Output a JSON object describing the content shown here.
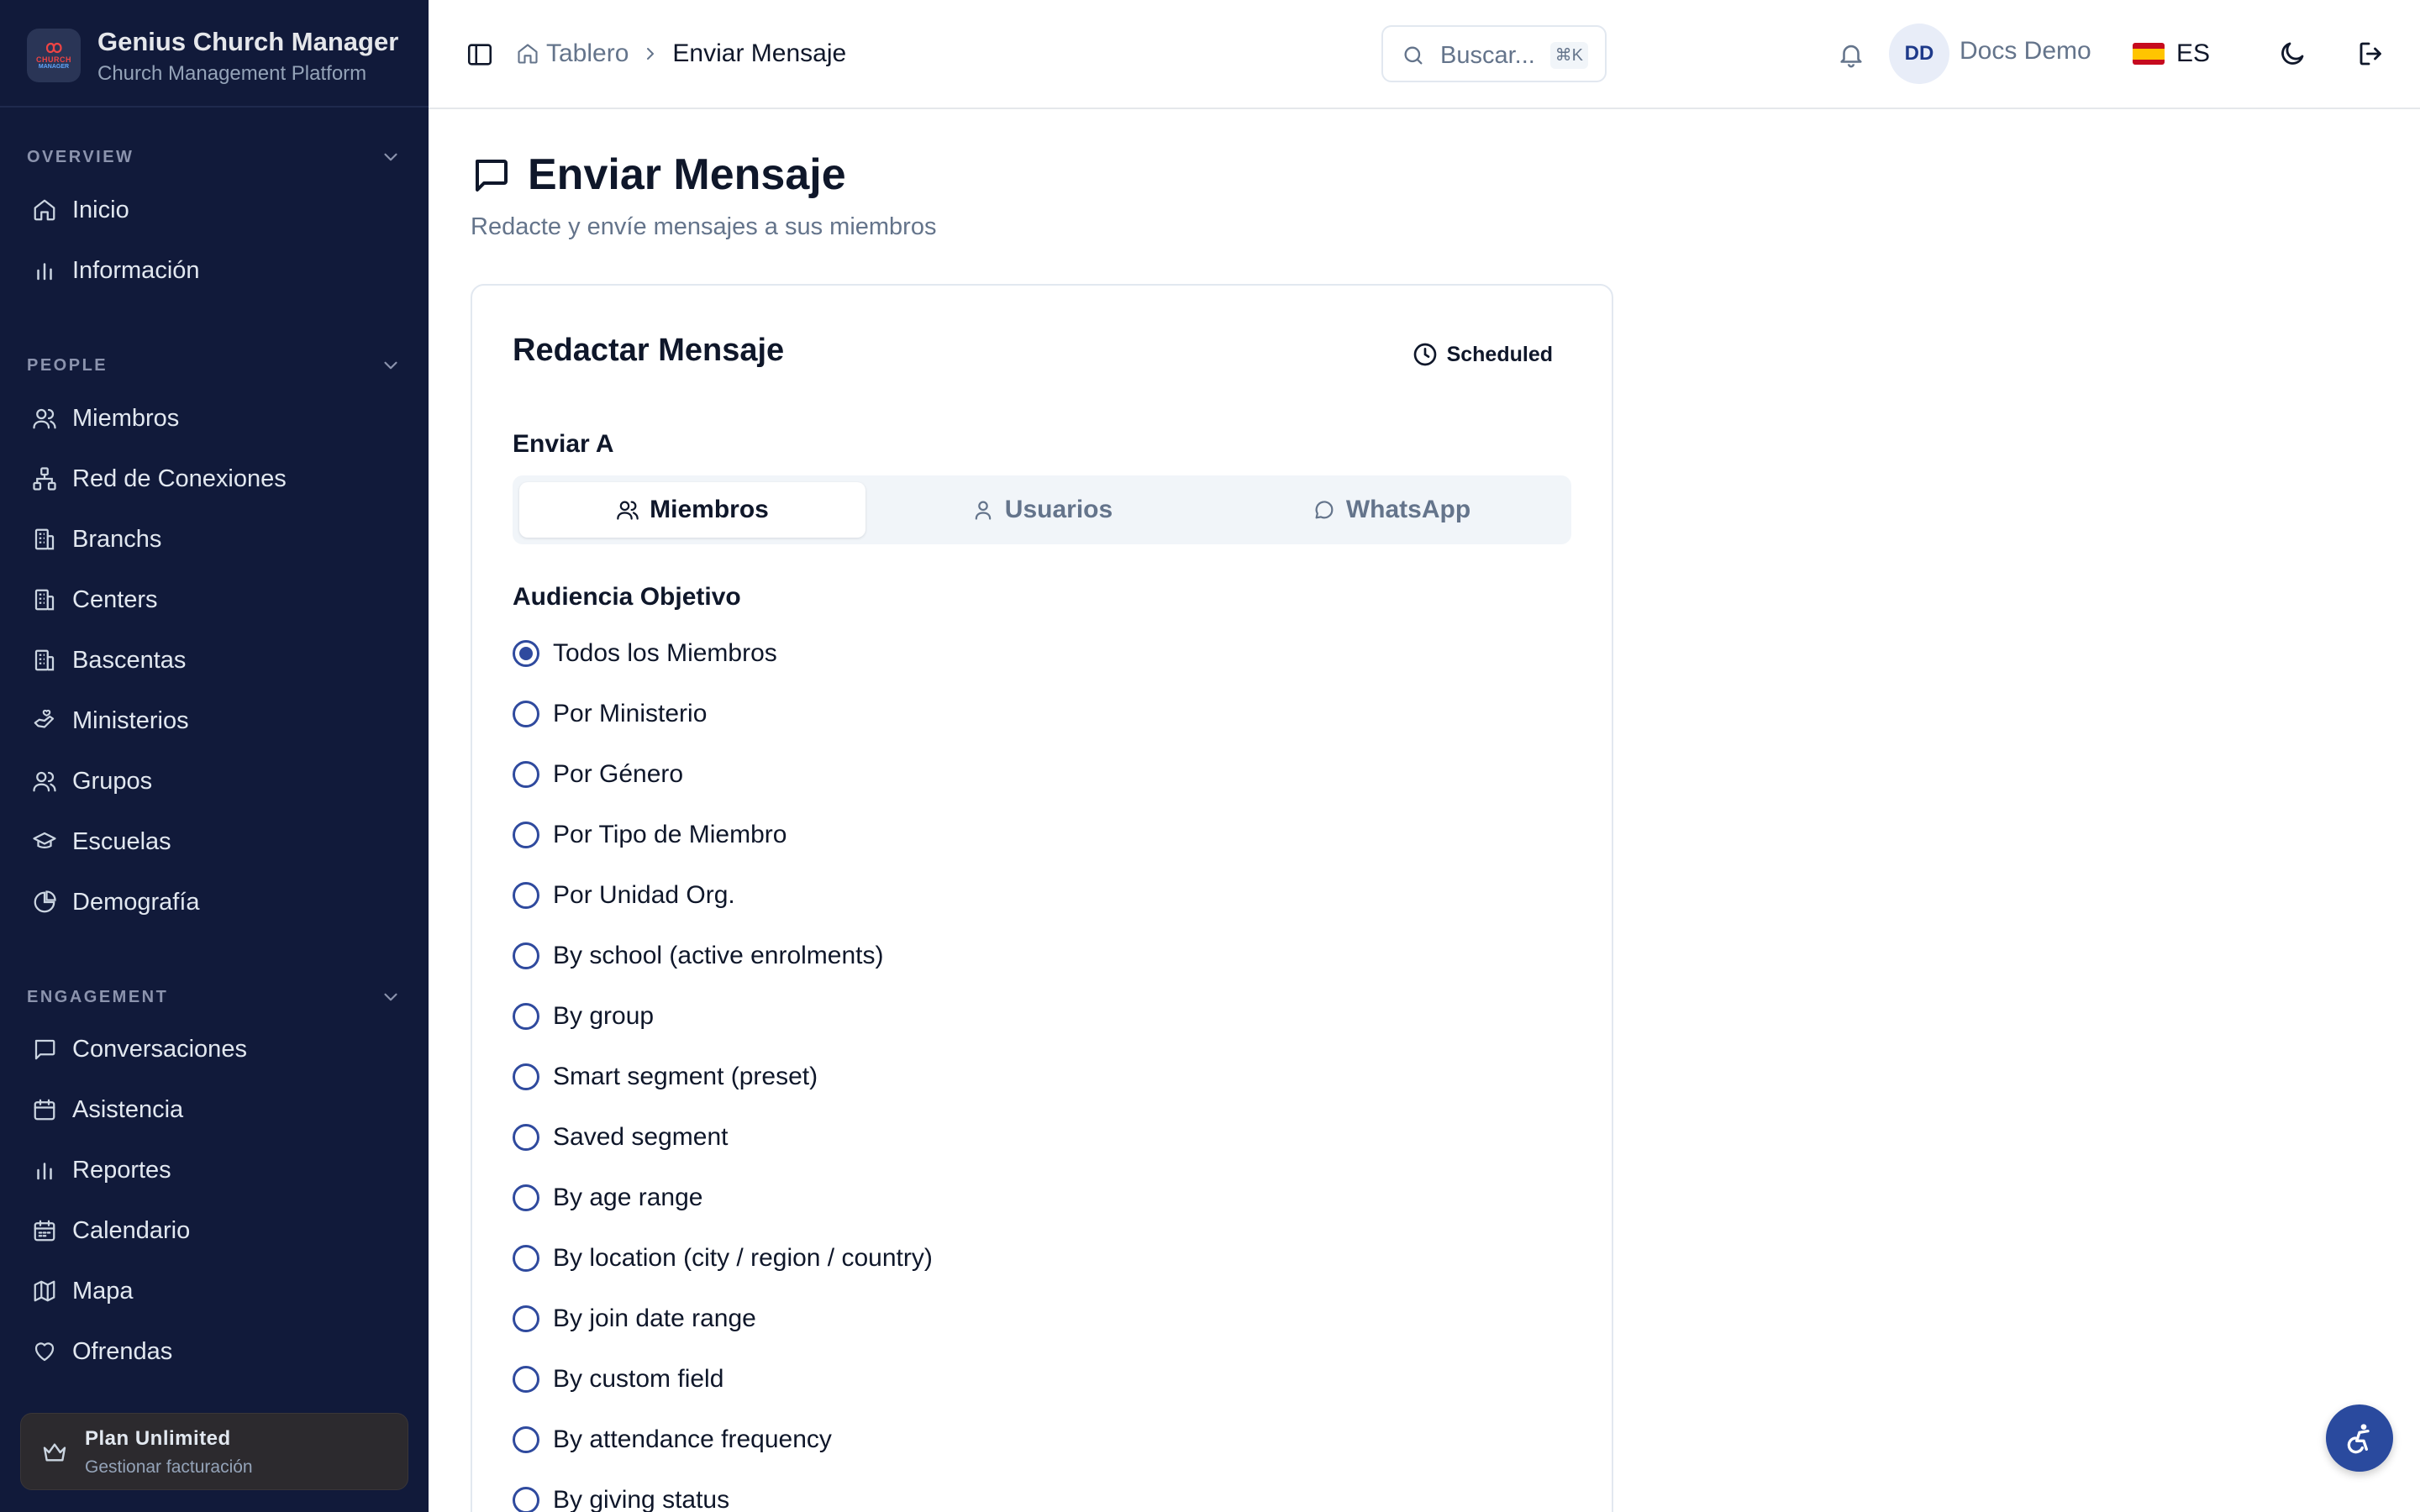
{
  "brand": {
    "title": "Genius Church Manager",
    "subtitle": "Church Management Platform",
    "logo_line1": "CHURCH",
    "logo_line2": "MANAGER"
  },
  "sidebar": {
    "sections": [
      {
        "heading": "OVERVIEW",
        "items": [
          "Inicio",
          "Información"
        ]
      },
      {
        "heading": "PEOPLE",
        "items": [
          "Miembros",
          "Red de Conexiones",
          "Branchs",
          "Centers",
          "Bascentas",
          "Ministerios",
          "Grupos",
          "Escuelas",
          "Demografía"
        ]
      },
      {
        "heading": "ENGAGEMENT",
        "items": [
          "Conversaciones",
          "Asistencia",
          "Reportes",
          "Calendario",
          "Mapa",
          "Ofrendas"
        ]
      }
    ],
    "plan": {
      "title": "Plan Unlimited",
      "subtitle": "Gestionar facturación"
    }
  },
  "header": {
    "breadcrumb_root": "Tablero",
    "breadcrumb_current": "Enviar Mensaje",
    "search_placeholder": "Buscar...",
    "search_shortcut": "⌘K",
    "avatar_initials": "DD",
    "user_name": "Docs Demo",
    "language_flag": "🇪🇸",
    "language": "ES"
  },
  "page": {
    "title": "Enviar Mensaje",
    "subtitle": "Redacte y envíe mensajes a sus miembros"
  },
  "compose": {
    "title": "Redactar Mensaje",
    "badge": "Scheduled",
    "send_to_label": "Enviar A",
    "tabs": [
      "Miembros",
      "Usuarios",
      "WhatsApp"
    ],
    "active_tab": "Miembros",
    "audience_label": "Audiencia Objetivo",
    "audience_options": [
      "Todos los Miembros",
      "Por Ministerio",
      "Por Género",
      "Por Tipo de Miembro",
      "Por Unidad Org.",
      "By school (active enrolments)",
      "By group",
      "Smart segment (preset)",
      "Saved segment",
      "By age range",
      "By location (city / region / country)",
      "By join date range",
      "By custom field",
      "By attendance frequency",
      "By giving status"
    ],
    "selected_audience": "Todos los Miembros"
  },
  "colors": {
    "sidebar_bg": "#111a3a",
    "accent": "#2f4a9e",
    "spain_red": "#c60b1e",
    "spain_yellow": "#ffc400"
  }
}
